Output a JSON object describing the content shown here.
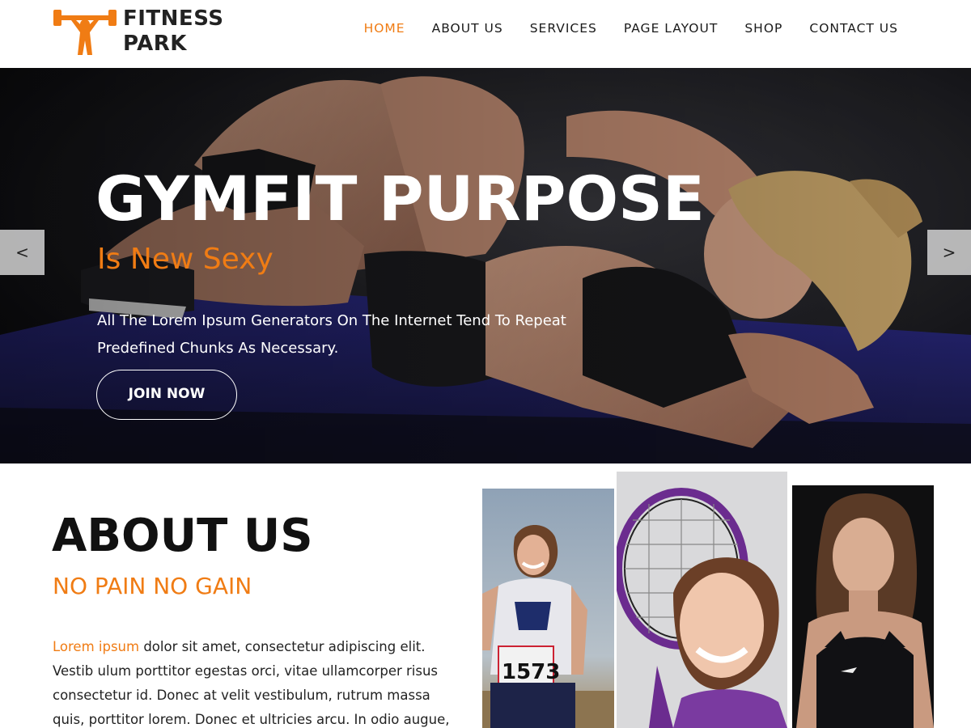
{
  "header": {
    "logo_line1": "FITNESS",
    "logo_line2": "PARK",
    "nav": [
      {
        "label": "HOME",
        "active": true
      },
      {
        "label": "ABOUT US",
        "active": false
      },
      {
        "label": "SERVICES",
        "active": false
      },
      {
        "label": "PAGE LAYOUT",
        "active": false
      },
      {
        "label": "SHOP",
        "active": false
      },
      {
        "label": "CONTACT US",
        "active": false
      }
    ]
  },
  "hero": {
    "title": "GYMFIT PURPOSE",
    "subtitle": "Is New Sexy",
    "text_line1": "All The Lorem Ipsum Generators On The Internet Tend To Repeat",
    "text_line2": "Predefined Chunks As Necessary.",
    "button": "JOIN NOW",
    "prev_arrow": "<",
    "next_arrow": ">"
  },
  "about": {
    "title": "ABOUT US",
    "subtitle": "NO PAIN NO GAIN",
    "highlight": "Lorem ipsum",
    "line1_rest": " dolor sit amet, consectetur adipiscing elit.",
    "line2": "Vestib ulum porttitor egestas orci, vitae ullamcorper risus",
    "line3": "consectetur id. Donec at velit vestibulum, rutrum massa",
    "line4": "quis, porttitor lorem. Donec et ultricies arcu. In odio augue,"
  },
  "gallery": {
    "runner_bib": "1573"
  },
  "colors": {
    "accent": "#f07c14",
    "text": "#111111",
    "hero_bg": "#151517",
    "mat_blue": "#2c2a7a"
  }
}
